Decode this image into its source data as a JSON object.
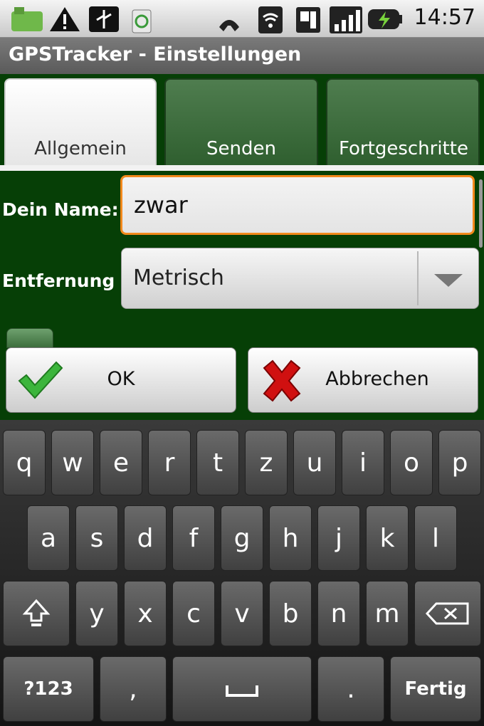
{
  "status_bar": {
    "icons": [
      "notification-app-icon",
      "warning-icon",
      "usb-icon",
      "recycle-icon",
      "missed-call-icon",
      "wifi-icon",
      "sim-icon",
      "signal-icon",
      "battery-charging-icon"
    ],
    "time": "14:57"
  },
  "title_bar": {
    "title": "GPSTracker - Einstellungen"
  },
  "tabs": [
    {
      "label": "Allgemein",
      "active": true
    },
    {
      "label": "Senden",
      "active": false
    },
    {
      "label": "Fortgeschritte",
      "active": false
    }
  ],
  "form": {
    "name_label": "Dein Name:",
    "name_value": "zwar",
    "distance_label": "Entfernung",
    "distance_value": "Metrisch"
  },
  "buttons": {
    "ok": "OK",
    "cancel": "Abbrechen"
  },
  "keyboard": {
    "row1": [
      "q",
      "w",
      "e",
      "r",
      "t",
      "z",
      "u",
      "i",
      "o",
      "p"
    ],
    "row2": [
      "a",
      "s",
      "d",
      "f",
      "g",
      "h",
      "j",
      "k",
      "l"
    ],
    "row3": [
      "y",
      "x",
      "c",
      "v",
      "b",
      "n",
      "m"
    ],
    "symbols_key": "?123",
    "comma_key": ",",
    "period_key": ".",
    "done_key": "Fertig"
  },
  "colors": {
    "background_green": "#063f06",
    "focus_orange": "#f2891c",
    "ok_check": "#3cb53c",
    "cancel_x": "#d01010"
  }
}
